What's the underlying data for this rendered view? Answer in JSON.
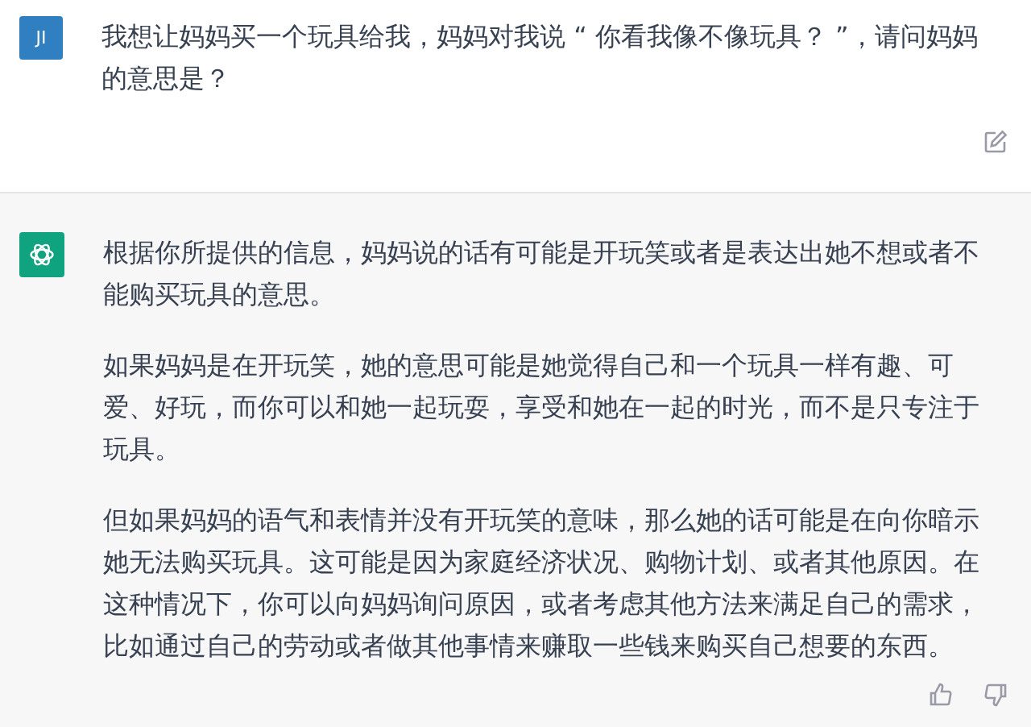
{
  "messages": [
    {
      "kind": "user",
      "avatar": "JI",
      "paragraphs": [
        "我想让妈妈买一个玩具给我，妈妈对我说 “ 你看我像不像玩具？ ”，请问妈妈的意思是？"
      ]
    },
    {
      "kind": "assistant",
      "paragraphs": [
        "根据你所提供的信息，妈妈说的话有可能是开玩笑或者是表达出她不想或者不能购买玩具的意思。",
        "如果妈妈是在开玩笑，她的意思可能是她觉得自己和一个玩具一样有趣、可爱、好玩，而你可以和她一起玩耍，享受和她在一起的时光，而不是只专注于玩具。",
        "但如果妈妈的语气和表情并没有开玩笑的意味，那么她的话可能是在向你暗示她无法购买玩具。这可能是因为家庭经济状况、购物计划、或者其他原因。在这种情况下，你可以向妈妈询问原因，或者考虑其他方法来满足自己的需求，比如通过自己的劳动或者做其他事情来赚取一些钱来购买自己想要的东西。"
      ]
    }
  ]
}
